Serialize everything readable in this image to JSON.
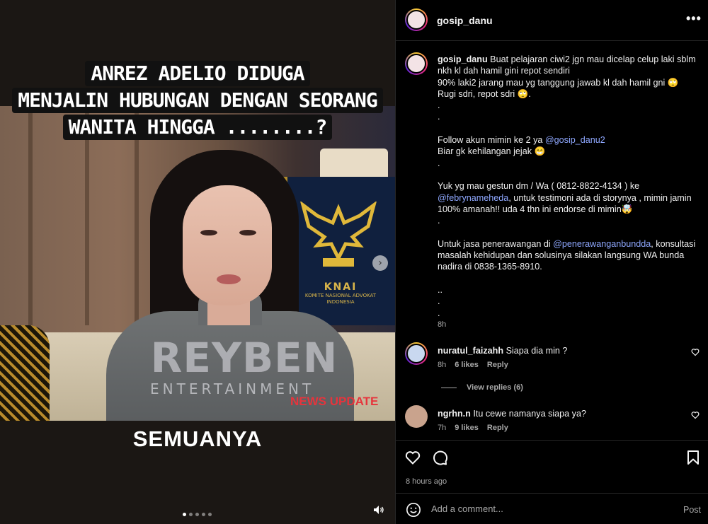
{
  "media": {
    "headline_lines": [
      "ANREZ ADELIO DIDUGA",
      "MENJALIN HUBUNGAN DENGAN SEORANG",
      "WANITA HINGGA ........?"
    ],
    "bottom_caption": "SEMUANYA",
    "watermark": "REYBEN",
    "watermark_sub": "ENTERTAINMENT",
    "news_badge": "NEWS UPDATE",
    "banner_text": "KOMITE NASIONAL ADVOKAT INDONESIA",
    "banner_logo": "KNAI",
    "carousel_count": 5,
    "carousel_active": 0,
    "next_icon": "chevron-right-icon",
    "volume_icon": "speaker-icon"
  },
  "header": {
    "username": "gosip_danu",
    "more_icon": "more-horizontal-icon"
  },
  "caption": {
    "username": "gosip_danu",
    "line1": "Buat pelajaran ciwi2 jgn mau dicelap celup laki sblm nkh kl dah hamil gini repot sendiri",
    "line2": "90% laki2 jarang mau yg tanggung jawab kl dah hamil gni 🙄",
    "line3": "Rugi sdri, repot sdri 🙄.",
    "dot1": ".",
    "dot2": ".",
    "follow_text": "Follow akun mimin ke 2 ya ",
    "follow_mention": "@gosip_danu2",
    "follow_line2": "Biar gk kehilangan jejak 😁",
    "dot3": ".",
    "gestun_text": "Yuk yg mau gestun dm / Wa ( 0812-8822-4134 ) ke",
    "gestun_mention": "@febrynameheda",
    "gestun_rest": ", untuk testimoni ada di storynya , mimin jamin 100% amanah!! uda 4 thn ini endorse di mimin🤯",
    "dot4": ".",
    "jasa_text": "Untuk jasa penerawangan di ",
    "jasa_mention": "@penerawanganbundda",
    "jasa_rest": ", konsultasi masalah kehidupan dan solusinya silakan langsung WA bunda nadira di 0838-1365-8910.",
    "dot5": "..",
    "dot6": ".",
    "dot7": ".",
    "time": "8h"
  },
  "comments": [
    {
      "username": "nuratul_faizahh",
      "text": "Siapa dia min ?",
      "time": "8h",
      "likes": "6 likes",
      "reply": "Reply",
      "view_replies": "View replies (6)"
    },
    {
      "username": "ngrhn.n",
      "text": "Itu cewe namanya siapa ya?",
      "time": "7h",
      "likes": "9 likes",
      "reply": "Reply"
    }
  ],
  "actions": {
    "like_icon": "heart-icon",
    "comment_icon": "comment-icon",
    "save_icon": "bookmark-icon",
    "time_ago": "8 hours ago"
  },
  "add_comment": {
    "placeholder": "Add a comment...",
    "post_label": "Post",
    "emoji_icon": "emoji-icon"
  }
}
